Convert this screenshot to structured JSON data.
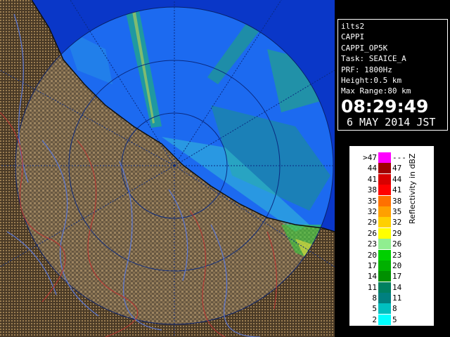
{
  "info": {
    "station": "ilts2",
    "product": "CAPPI",
    "product_code": "CAPPI_OP5K",
    "task": "Task: SEAICE_A",
    "prf": "PRF: 1800Hz",
    "height": "Height:0.5 km",
    "max_range": "Max Range:80 km",
    "time": "08:29:49",
    "date": "6 MAY 2014 JST"
  },
  "legend": {
    "unit_label": "Reflectivity in dBZ",
    "rows": [
      {
        "lo": ">47",
        "hi": "---",
        "color": "#ff00ff"
      },
      {
        "lo": "44",
        "hi": "47",
        "color": "#a00000"
      },
      {
        "lo": "41",
        "hi": "44",
        "color": "#d80000"
      },
      {
        "lo": "38",
        "hi": "41",
        "color": "#ff0000"
      },
      {
        "lo": "35",
        "hi": "38",
        "color": "#ff7000"
      },
      {
        "lo": "32",
        "hi": "35",
        "color": "#ffa000"
      },
      {
        "lo": "29",
        "hi": "32",
        "color": "#ffd000"
      },
      {
        "lo": "26",
        "hi": "29",
        "color": "#ffff00"
      },
      {
        "lo": "23",
        "hi": "26",
        "color": "#90ee90"
      },
      {
        "lo": "20",
        "hi": "23",
        "color": "#00d000"
      },
      {
        "lo": "17",
        "hi": "20",
        "color": "#00b000"
      },
      {
        "lo": "14",
        "hi": "17",
        "color": "#009000"
      },
      {
        "lo": "11",
        "hi": "14",
        "color": "#008060"
      },
      {
        "lo": "8",
        "hi": "11",
        "color": "#008080"
      },
      {
        "lo": "5",
        "hi": "8",
        "color": "#00c0c0"
      },
      {
        "lo": "2",
        "hi": "5",
        "color": "#00ffff"
      }
    ]
  },
  "map_colors": {
    "sea_background": "#0a37c8",
    "sea_inside_range": "#1c6af0",
    "land_dark": "#5a4a32",
    "land_light": "#b09060",
    "river": "#5a78d8",
    "boundary": "#c03030"
  }
}
